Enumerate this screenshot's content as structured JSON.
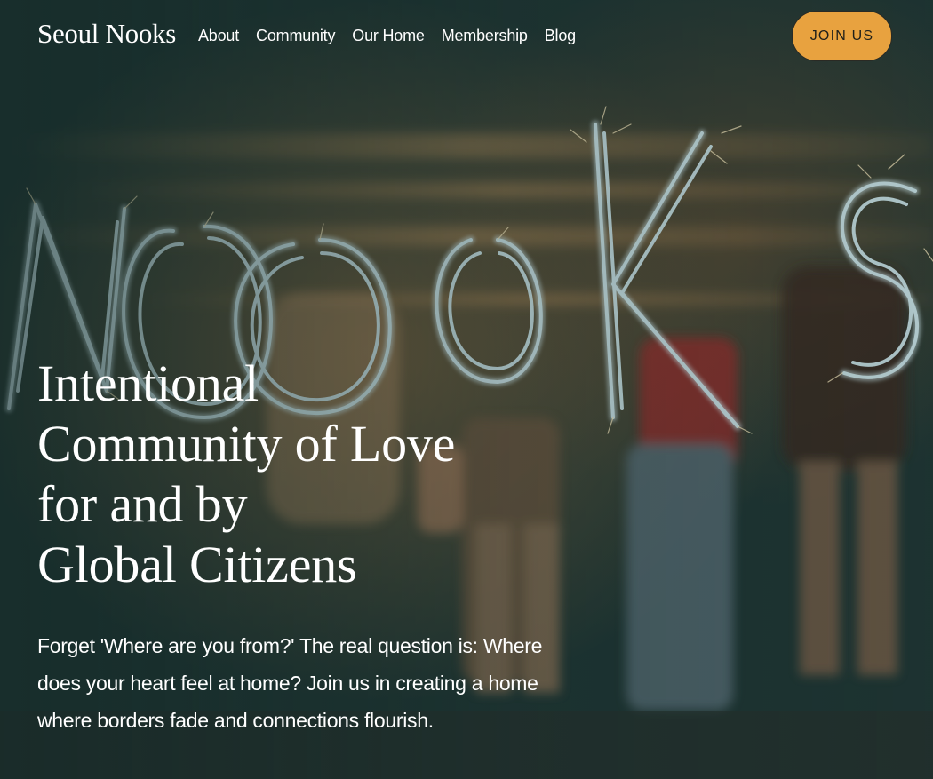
{
  "site": {
    "logo": "Seoul Nooks"
  },
  "nav": {
    "items": [
      {
        "label": "About"
      },
      {
        "label": "Community"
      },
      {
        "label": "Our Home"
      },
      {
        "label": "Membership"
      },
      {
        "label": "Blog"
      }
    ]
  },
  "header": {
    "cta_label": "JOIN US"
  },
  "hero": {
    "image_lettering": "NOOKS",
    "headline_lines": [
      "Intentional",
      "Community of Love",
      "for and by",
      "Global Citizens"
    ],
    "subtext": "Forget 'Where are you from?' The real question is: Where does your heart feel at home? Join us in creating a home where borders fade and connections flourish."
  },
  "colors": {
    "background": "#1d3230",
    "text": "#ffffff",
    "cta_background": "#e8a23f",
    "cta_text": "#1f1f1a",
    "sparkler": "#cfe7ec"
  }
}
